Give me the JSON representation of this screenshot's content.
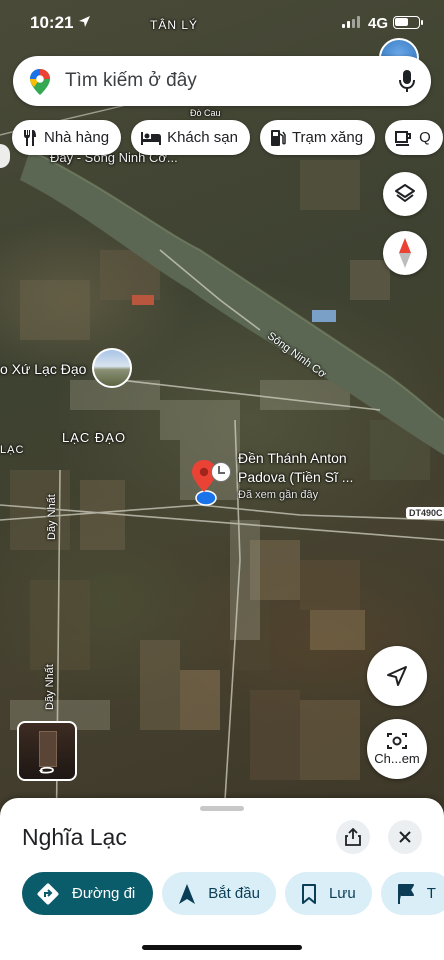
{
  "status_bar": {
    "time": "10:21",
    "network": "4G"
  },
  "search": {
    "placeholder": "Tìm kiếm ở đây"
  },
  "chips": [
    {
      "label": "Nhà hàng",
      "icon": "restaurant-icon"
    },
    {
      "label": "Khách sạn",
      "icon": "hotel-icon"
    },
    {
      "label": "Trạm xăng",
      "icon": "gas-station-icon"
    },
    {
      "label": "Q",
      "icon": "coffee-icon"
    }
  ],
  "map": {
    "labels": {
      "tan_ly": "TÂN LÝ",
      "song_ninh_co_area": "Đây - Sông Ninh Cơ...",
      "river": "Sông Ninh Cơ",
      "xu_lac_dao": "o Xứ Lạc Đạo",
      "lac_dao": "LẠC ĐẠO",
      "lac": "LẠC",
      "day_nhat_1": "Dãy Nhất",
      "day_nhat_2": "Dãy Nhất",
      "road": "DT490C",
      "do_cau": "Đò Cau"
    },
    "place": {
      "name_line1": "Đền Thánh Anton",
      "name_line2": "Padova (Tiền Sĩ ...",
      "subtitle": "Đã xem gần đây"
    }
  },
  "camera_button": {
    "label": "Ch...em"
  },
  "sheet": {
    "title": "Nghĩa Lạc",
    "actions": [
      {
        "label": "Đường đi",
        "icon": "directions-icon"
      },
      {
        "label": "Bắt đầu",
        "icon": "navigation-arrow-icon"
      },
      {
        "label": "Lưu",
        "icon": "bookmark-icon"
      },
      {
        "label": "T",
        "icon": "flag-icon"
      }
    ]
  },
  "colors": {
    "primary_action": "#0b5c6b",
    "secondary_action": "#d9eef6",
    "pin_red": "#ea4335",
    "location_blue": "#1a73e8"
  }
}
